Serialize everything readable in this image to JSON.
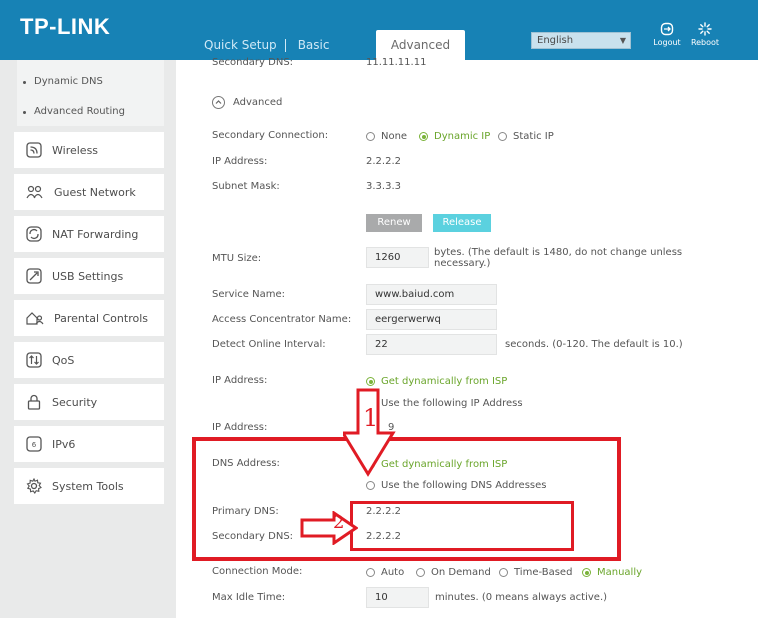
{
  "header": {
    "brand": "TP-LINK",
    "nav": [
      "Quick Setup",
      "Basic"
    ],
    "active_tab": "Advanced",
    "language": "English",
    "logout": "Logout",
    "reboot": "Reboot"
  },
  "sidebar": {
    "sub_items": [
      "Dynamic DNS",
      "Advanced Routing"
    ],
    "items": [
      "Wireless",
      "Guest Network",
      "NAT Forwarding",
      "USB Settings",
      "Parental Controls",
      "QoS",
      "Security",
      "IPv6",
      "System Tools"
    ]
  },
  "form": {
    "partial_label": "Secondary DNS:",
    "partial_value": "11.11.11.11",
    "advanced": "Advanced",
    "secondary_connection": {
      "label": "Secondary Connection:",
      "options": [
        "None",
        "Dynamic IP",
        "Static IP"
      ]
    },
    "ip_address": {
      "label": "IP Address:",
      "value": "2.2.2.2"
    },
    "subnet_mask": {
      "label": "Subnet Mask:",
      "value": "3.3.3.3"
    },
    "renew": "Renew",
    "release": "Release",
    "mtu": {
      "label": "MTU Size:",
      "value": "1260",
      "hint": "bytes. (The default is 1480, do not change unless necessary.)"
    },
    "service_name": {
      "label": "Service Name:",
      "value": "www.baiud.com"
    },
    "access_concentrator": {
      "label": "Access Concentrator Name:",
      "value": "eergerwerwq"
    },
    "detect_interval": {
      "label": "Detect Online Interval:",
      "value": "22",
      "hint": "seconds. (0-120. The default is 10.)"
    },
    "ip_mode": {
      "label": "IP Address:",
      "options": [
        "Get dynamically from ISP",
        "Use the following IP Address"
      ]
    },
    "ip_address2": {
      "label": "IP Address:",
      "value": "9"
    },
    "dns_mode": {
      "label": "DNS Address:",
      "options": [
        "Get dynamically from ISP",
        "Use the following DNS Addresses"
      ]
    },
    "primary_dns": {
      "label": "Primary DNS:",
      "value": "2.2.2.2"
    },
    "secondary_dns": {
      "label": "Secondary DNS:",
      "value": "2.2.2.2"
    },
    "connection_mode": {
      "label": "Connection Mode:",
      "options": [
        "Auto",
        "On Demand",
        "Time-Based",
        "Manually"
      ]
    },
    "max_idle": {
      "label": "Max Idle Time:",
      "value": "10",
      "hint": "minutes. (0 means always active.)"
    }
  },
  "annotations": {
    "step1": "1",
    "step2": "2"
  },
  "colors": {
    "header_blue": "#1782b5",
    "accent_green": "#7bb33a",
    "annotation_red": "#e01b24",
    "release_cyan": "#5bd1df"
  }
}
